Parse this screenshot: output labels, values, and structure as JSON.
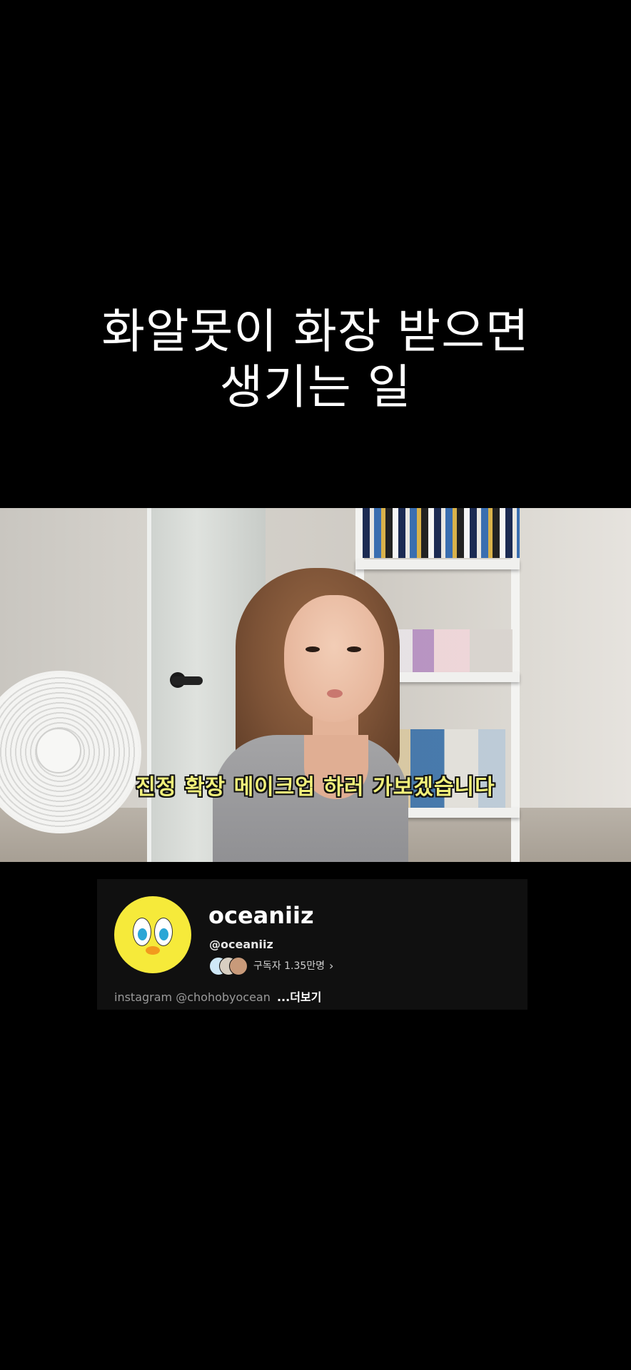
{
  "title": {
    "line1": "화알못이 화장 받으면",
    "line2": "생기는 일"
  },
  "video": {
    "subtitle": "진정 확장 메이크업 하러 가보겠습니다"
  },
  "channel": {
    "name": "oceaniiz",
    "handle": "@oceaniiz",
    "subscribers": "구독자 1.35만명",
    "description": "instagram @chohobyocean",
    "more_label": "...더보기"
  },
  "colors": {
    "background": "#000000",
    "card_background": "#101010",
    "subtitle_text": "#f1f07a",
    "avatar_yellow": "#f6ea3a"
  }
}
